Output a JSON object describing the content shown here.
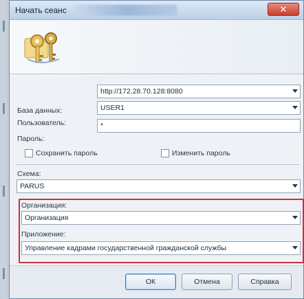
{
  "window": {
    "title": "Начать сеанс",
    "close_label": "✕"
  },
  "icons": {
    "banner": "keys-icon",
    "dropdown": "chevron-down-icon",
    "close": "close-icon"
  },
  "form": {
    "database": {
      "label": "База данных:",
      "value": "http://172.28.70.128:8080"
    },
    "user": {
      "label": "Пользователь:",
      "value": "USER1"
    },
    "password": {
      "label": "Пароль:",
      "value": "*"
    },
    "save_password": {
      "label": "Сохранить пароль",
      "checked": false
    },
    "change_password": {
      "label": "Изменить пароль",
      "checked": false
    },
    "schema": {
      "label": "Схема:",
      "value": "PARUS"
    },
    "organization": {
      "label": "Организация:",
      "value": "Организация"
    },
    "application": {
      "label": "Приложение:",
      "value": "Управление кадрами государственной гражданской службы"
    }
  },
  "buttons": {
    "ok": "ОК",
    "cancel": "Отмена",
    "help": "Справка"
  },
  "colors": {
    "highlight": "#c9303a",
    "close_button": "#c9402d"
  }
}
